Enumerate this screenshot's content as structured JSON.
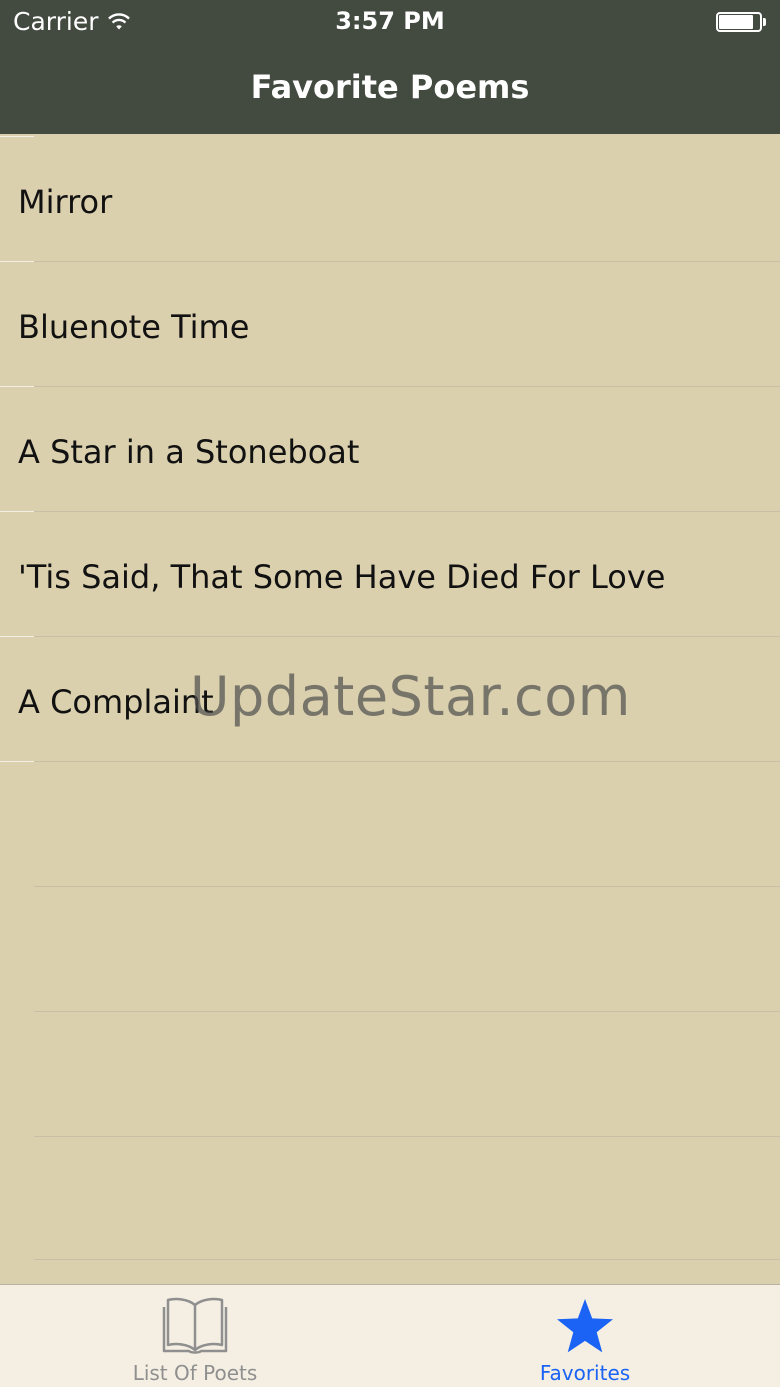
{
  "status_bar": {
    "carrier": "Carrier",
    "time": "3:57 PM"
  },
  "nav": {
    "title": "Favorite Poems"
  },
  "poems": [
    "Mirror",
    "Bluenote Time",
    "A Star in a Stoneboat",
    "'Tis Said, That Some Have Died For Love",
    "A Complaint"
  ],
  "watermark": "UpdateStar.com",
  "tabbar": {
    "tabs": [
      {
        "label": "List Of Poets",
        "icon": "book-icon",
        "selected": false
      },
      {
        "label": "Favorites",
        "icon": "star-icon",
        "selected": true
      }
    ]
  },
  "colors": {
    "nav_background": "#434a40",
    "list_background": "#dbd0ae",
    "tab_selected": "#1a63f5",
    "tab_unselected": "#8f8f8f"
  }
}
